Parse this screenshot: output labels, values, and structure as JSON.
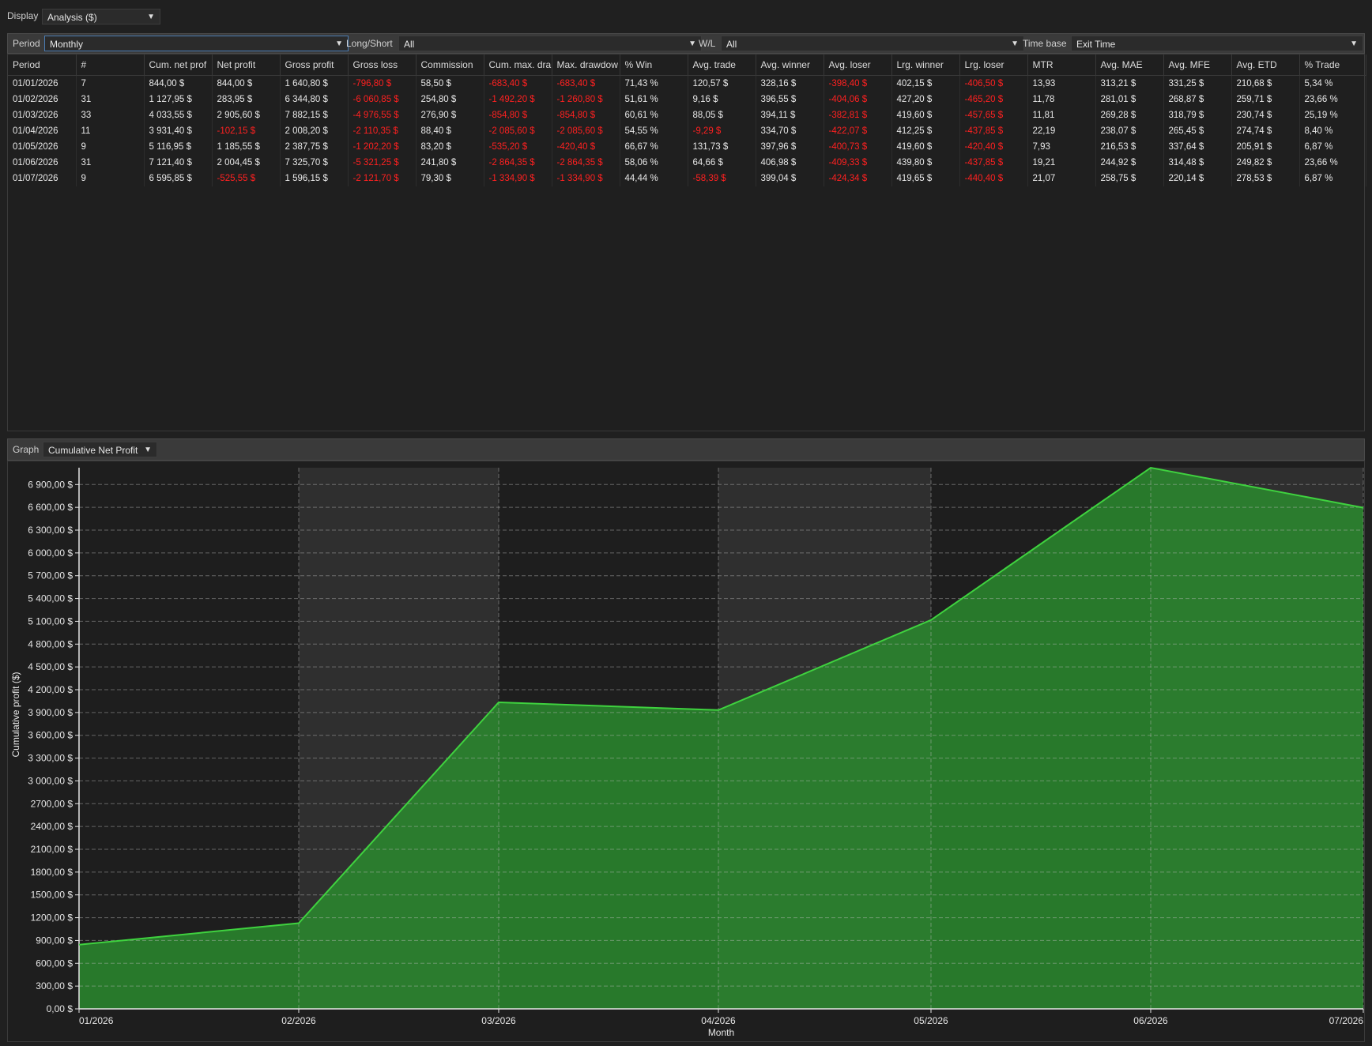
{
  "display": {
    "label": "Display",
    "value": "Analysis ($)"
  },
  "filters": {
    "period_label": "Period",
    "period_value": "Monthly",
    "longshort_label": "Long/Short",
    "longshort_value": "All",
    "wl_label": "W/L",
    "wl_value": "All",
    "timebase_label": "Time base",
    "timebase_value": "Exit Time"
  },
  "table": {
    "columns": [
      "Period",
      "#",
      "Cum. net prof",
      "Net profit",
      "Gross profit",
      "Gross loss",
      "Commission",
      "Cum. max. dra",
      "Max. drawdow",
      "% Win",
      "Avg. trade",
      "Avg. winner",
      "Avg. loser",
      "Lrg. winner",
      "Lrg. loser",
      "MTR",
      "Avg. MAE",
      "Avg. MFE",
      "Avg. ETD",
      "% Trade"
    ],
    "rows": [
      [
        "01/01/2026",
        "7",
        "844,00 $",
        "844,00 $",
        "1 640,80 $",
        "-796,80 $",
        "58,50 $",
        "-683,40 $",
        "-683,40 $",
        "71,43 %",
        "120,57 $",
        "328,16 $",
        "-398,40 $",
        "402,15 $",
        "-406,50 $",
        "13,93",
        "313,21 $",
        "331,25 $",
        "210,68 $",
        "5,34 %"
      ],
      [
        "01/02/2026",
        "31",
        "1 127,95 $",
        "283,95 $",
        "6 344,80 $",
        "-6 060,85 $",
        "254,80 $",
        "-1 492,20 $",
        "-1 260,80 $",
        "51,61 %",
        "9,16 $",
        "396,55 $",
        "-404,06 $",
        "427,20 $",
        "-465,20 $",
        "11,78",
        "281,01 $",
        "268,87 $",
        "259,71 $",
        "23,66 %"
      ],
      [
        "01/03/2026",
        "33",
        "4 033,55 $",
        "2 905,60 $",
        "7 882,15 $",
        "-4 976,55 $",
        "276,90 $",
        "-854,80 $",
        "-854,80 $",
        "60,61 %",
        "88,05 $",
        "394,11 $",
        "-382,81 $",
        "419,60 $",
        "-457,65 $",
        "11,81",
        "269,28 $",
        "318,79 $",
        "230,74 $",
        "25,19 %"
      ],
      [
        "01/04/2026",
        "11",
        "3 931,40 $",
        "-102,15 $",
        "2 008,20 $",
        "-2 110,35 $",
        "88,40 $",
        "-2 085,60 $",
        "-2 085,60 $",
        "54,55 %",
        "-9,29 $",
        "334,70 $",
        "-422,07 $",
        "412,25 $",
        "-437,85 $",
        "22,19",
        "238,07 $",
        "265,45 $",
        "274,74 $",
        "8,40 %"
      ],
      [
        "01/05/2026",
        "9",
        "5 116,95 $",
        "1 185,55 $",
        "2 387,75 $",
        "-1 202,20 $",
        "83,20 $",
        "-535,20 $",
        "-420,40 $",
        "66,67 %",
        "131,73 $",
        "397,96 $",
        "-400,73 $",
        "419,60 $",
        "-420,40 $",
        "7,93",
        "216,53 $",
        "337,64 $",
        "205,91 $",
        "6,87 %"
      ],
      [
        "01/06/2026",
        "31",
        "7 121,40 $",
        "2 004,45 $",
        "7 325,70 $",
        "-5 321,25 $",
        "241,80 $",
        "-2 864,35 $",
        "-2 864,35 $",
        "58,06 %",
        "64,66 $",
        "406,98 $",
        "-409,33 $",
        "439,80 $",
        "-437,85 $",
        "19,21",
        "244,92 $",
        "314,48 $",
        "249,82 $",
        "23,66 %"
      ],
      [
        "01/07/2026",
        "9",
        "6 595,85 $",
        "-525,55 $",
        "1 596,15 $",
        "-2 121,70 $",
        "79,30 $",
        "-1 334,90 $",
        "-1 334,90 $",
        "44,44 %",
        "-58,39 $",
        "399,04 $",
        "-424,34 $",
        "419,65 $",
        "-440,40 $",
        "21,07",
        "258,75 $",
        "220,14 $",
        "278,53 $",
        "6,87 %"
      ]
    ]
  },
  "graph": {
    "label": "Graph",
    "value": "Cumulative Net Profit"
  },
  "chart_data": {
    "type": "area",
    "xlabel": "Month",
    "ylabel": "Cumulative profit ($)",
    "categories": [
      "01/2026",
      "02/2026",
      "03/2026",
      "04/2026",
      "05/2026",
      "06/2026",
      "07/2026"
    ],
    "values": [
      844.0,
      1127.95,
      4033.55,
      3931.4,
      5116.95,
      7121.4,
      6595.85
    ],
    "ylim": [
      0,
      7121.4
    ],
    "yticks": [
      0,
      300,
      600,
      900,
      1200,
      1500,
      1800,
      2100,
      2400,
      2700,
      3000,
      3300,
      3600,
      3900,
      4200,
      4500,
      4800,
      5100,
      5400,
      5700,
      6000,
      6300,
      6600,
      6900
    ],
    "ytick_labels": [
      "0,00 $",
      "300,00 $",
      "600,00 $",
      "900,00 $",
      "1200,00 $",
      "1500,00 $",
      "1800,00 $",
      "2100,00 $",
      "2400,00 $",
      "2700,00 $",
      "3 000,00 $",
      "3 300,00 $",
      "3 600,00 $",
      "3 900,00 $",
      "4 200,00 $",
      "4 500,00 $",
      "4 800,00 $",
      "5 100,00 $",
      "5 400,00 $",
      "5 700,00 $",
      "6 000,00 $",
      "6 300,00 $",
      "6 600,00 $",
      "6 900,00 $"
    ],
    "grid": true,
    "colors": {
      "fill": "#2a8a2e",
      "line": "#3fd23f",
      "band": "#2f2f2f",
      "negative": "#ff2020"
    }
  }
}
